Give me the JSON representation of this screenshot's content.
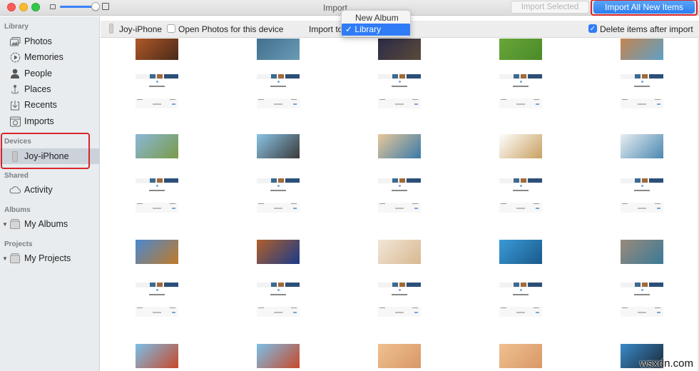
{
  "window": {
    "title": "Import",
    "zoom_slider_value": 0.9
  },
  "toolbar": {
    "import_selected_label": "Import Selected",
    "import_all_label": "Import All New Items",
    "import_selected_enabled": false
  },
  "sidebar": {
    "sections": [
      {
        "label": "Library",
        "items": [
          {
            "label": "Photos",
            "icon": "photos-icon"
          },
          {
            "label": "Memories",
            "icon": "memories-icon"
          },
          {
            "label": "People",
            "icon": "people-icon"
          },
          {
            "label": "Places",
            "icon": "places-icon"
          },
          {
            "label": "Recents",
            "icon": "recents-icon"
          },
          {
            "label": "Imports",
            "icon": "imports-icon"
          }
        ]
      },
      {
        "label": "Devices",
        "items": [
          {
            "label": "Joy-iPhone",
            "icon": "iphone-icon",
            "selected": true
          }
        ]
      },
      {
        "label": "Shared",
        "items": [
          {
            "label": "Activity",
            "icon": "cloud-icon"
          }
        ]
      },
      {
        "label": "Albums",
        "items": [
          {
            "label": "My Albums",
            "icon": "folder-icon",
            "expandable": true
          }
        ]
      },
      {
        "label": "Projects",
        "items": [
          {
            "label": "My Projects",
            "icon": "folder-icon",
            "expandable": true
          }
        ]
      }
    ]
  },
  "device_bar": {
    "device_name": "Joy-iPhone",
    "open_photos_label": "Open Photos for this device",
    "open_photos_checked": false,
    "import_to_label": "Import to",
    "delete_after_label": "Delete items after import",
    "delete_after_checked": true
  },
  "import_dropdown": {
    "options": [
      "New Album",
      "Library"
    ],
    "selected": "Library",
    "check_glyph": "✓"
  },
  "grid": {
    "columns": 5,
    "rows": [
      {
        "type": "photo",
        "colors": [
          [
            "#b45a2a",
            "#4a2a18"
          ],
          [
            "#3f6e8c",
            "#6a9ab4"
          ],
          [
            "#2a2a48",
            "#5a4a3a"
          ],
          [
            "#6aa83a",
            "#4a8a28"
          ],
          [
            "#c9834a",
            "#5ea0c6"
          ]
        ]
      },
      {
        "type": "screenshot"
      },
      {
        "type": "photo",
        "colors": [
          [
            "#8ab8d8",
            "#7a9a48"
          ],
          [
            "#8ac4e6",
            "#3a3a3a"
          ],
          [
            "#e8c89a",
            "#3a7aa8"
          ],
          [
            "#ffffff",
            "#c8a060"
          ],
          [
            "#e8eef2",
            "#4a88b0"
          ]
        ]
      },
      {
        "type": "screenshot"
      },
      {
        "type": "photo",
        "colors": [
          [
            "#4a88d0",
            "#c07a28"
          ],
          [
            "#b0602a",
            "#1a3a8a"
          ],
          [
            "#f2e6d8",
            "#d8b890"
          ],
          [
            "#3a9ad8",
            "#1a5a8a"
          ],
          [
            "#9a8a7a",
            "#3a7a98"
          ]
        ]
      },
      {
        "type": "screenshot"
      },
      {
        "type": "photo",
        "colors": [
          [
            "#7ac0e8",
            "#c8482a"
          ],
          [
            "#7ac0e8",
            "#c8482a"
          ],
          [
            "#f0c090",
            "#d89868"
          ],
          [
            "#f0c090",
            "#d89868"
          ],
          [
            "#3a8ac8",
            "#1a2a3a"
          ]
        ]
      }
    ]
  },
  "watermark": "wsxdn.com"
}
